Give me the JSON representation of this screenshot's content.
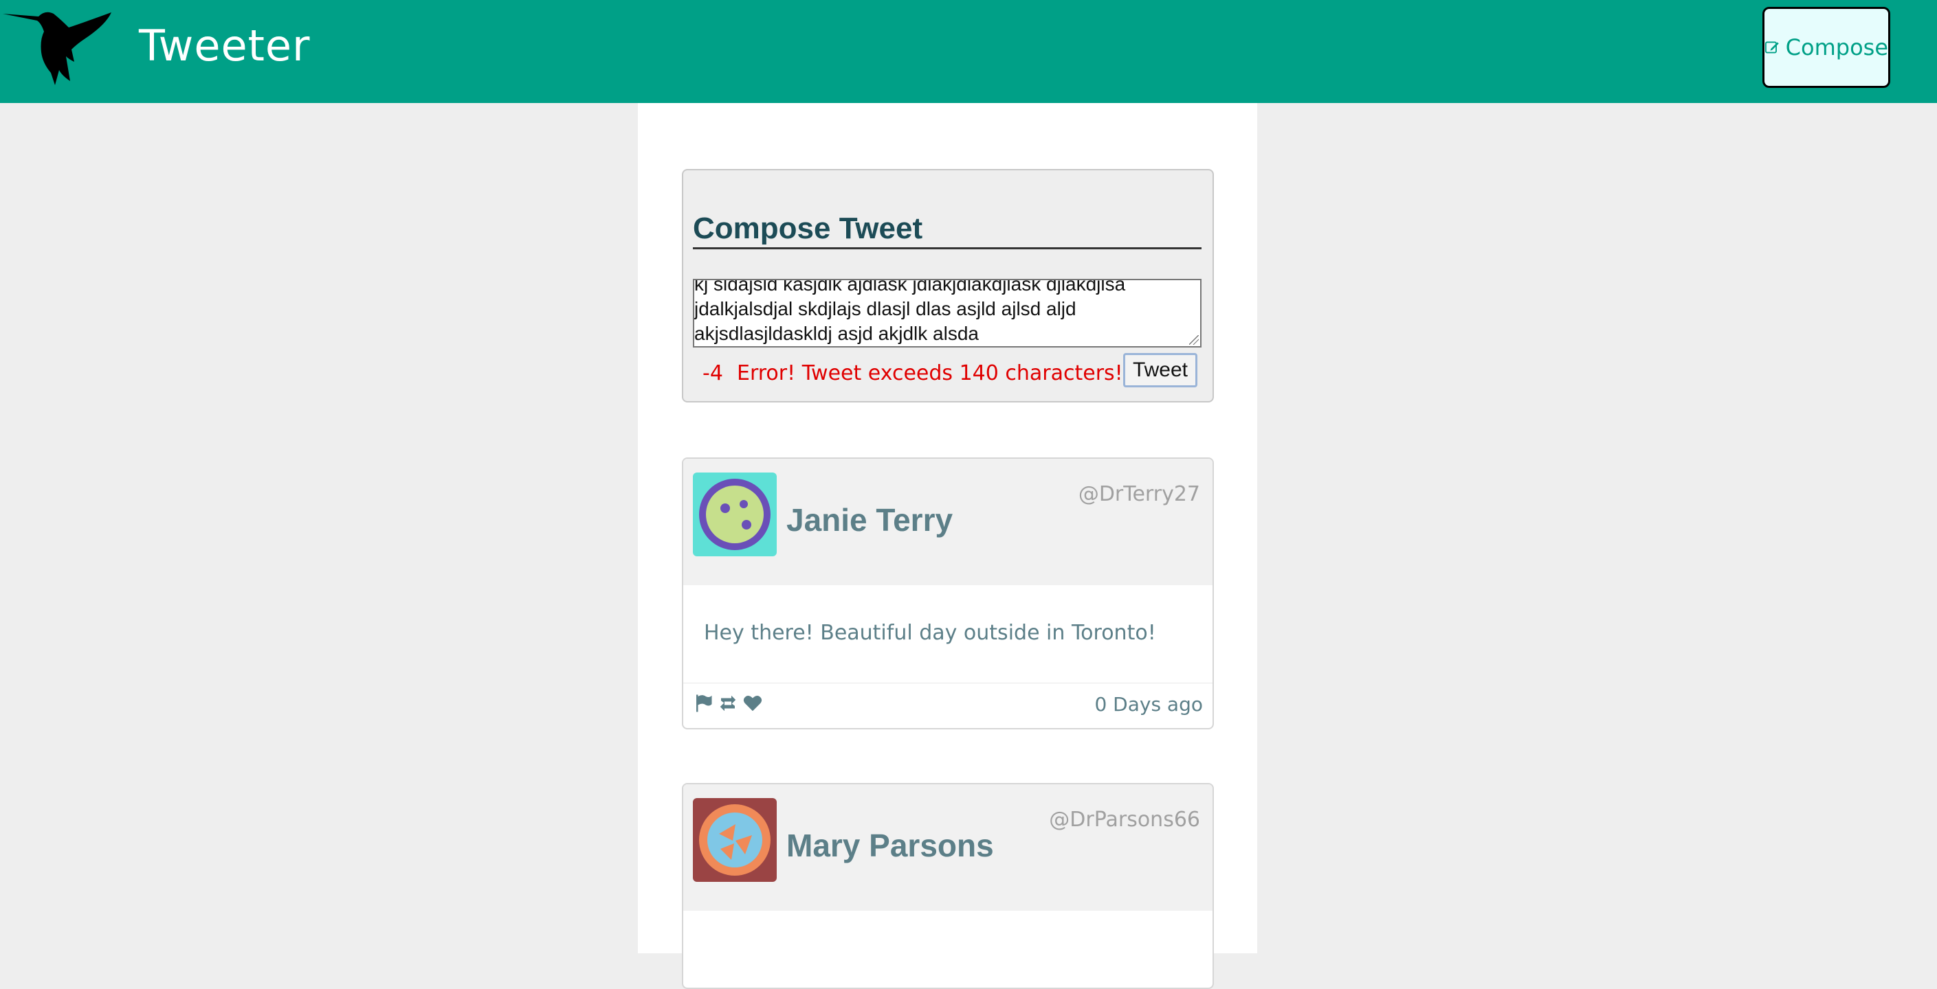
{
  "app": {
    "brand": "Tweeter",
    "compose_label": "Compose",
    "accent": "#00a087"
  },
  "compose": {
    "title": "Compose Tweet",
    "text_lines": [
      "kj sldajsld kasjdlk ajdlask jdlakjdlakdjlask djlakdjlsa",
      "jdalkjalsdjal skdjlajs dlasjl dlas asjld ajlsd aljd",
      "akjsdlasjldaskldj asjd akjdlk alsda"
    ],
    "counter": "-4",
    "error": "Error! Tweet exceeds 140 characters!",
    "submit_label": "Tweet",
    "error_color": "#e00000"
  },
  "tweets": [
    {
      "name": "Janie Terry",
      "handle": "@DrTerry27",
      "text": "Hey there! Beautiful day outside in Toronto!",
      "time": "0 Days ago",
      "avatar_icon": "smiley-avatar-icon"
    },
    {
      "name": "Mary Parsons",
      "handle": "@DrParsons66",
      "text": "",
      "time": "",
      "avatar_icon": "shapes-avatar-icon"
    }
  ]
}
